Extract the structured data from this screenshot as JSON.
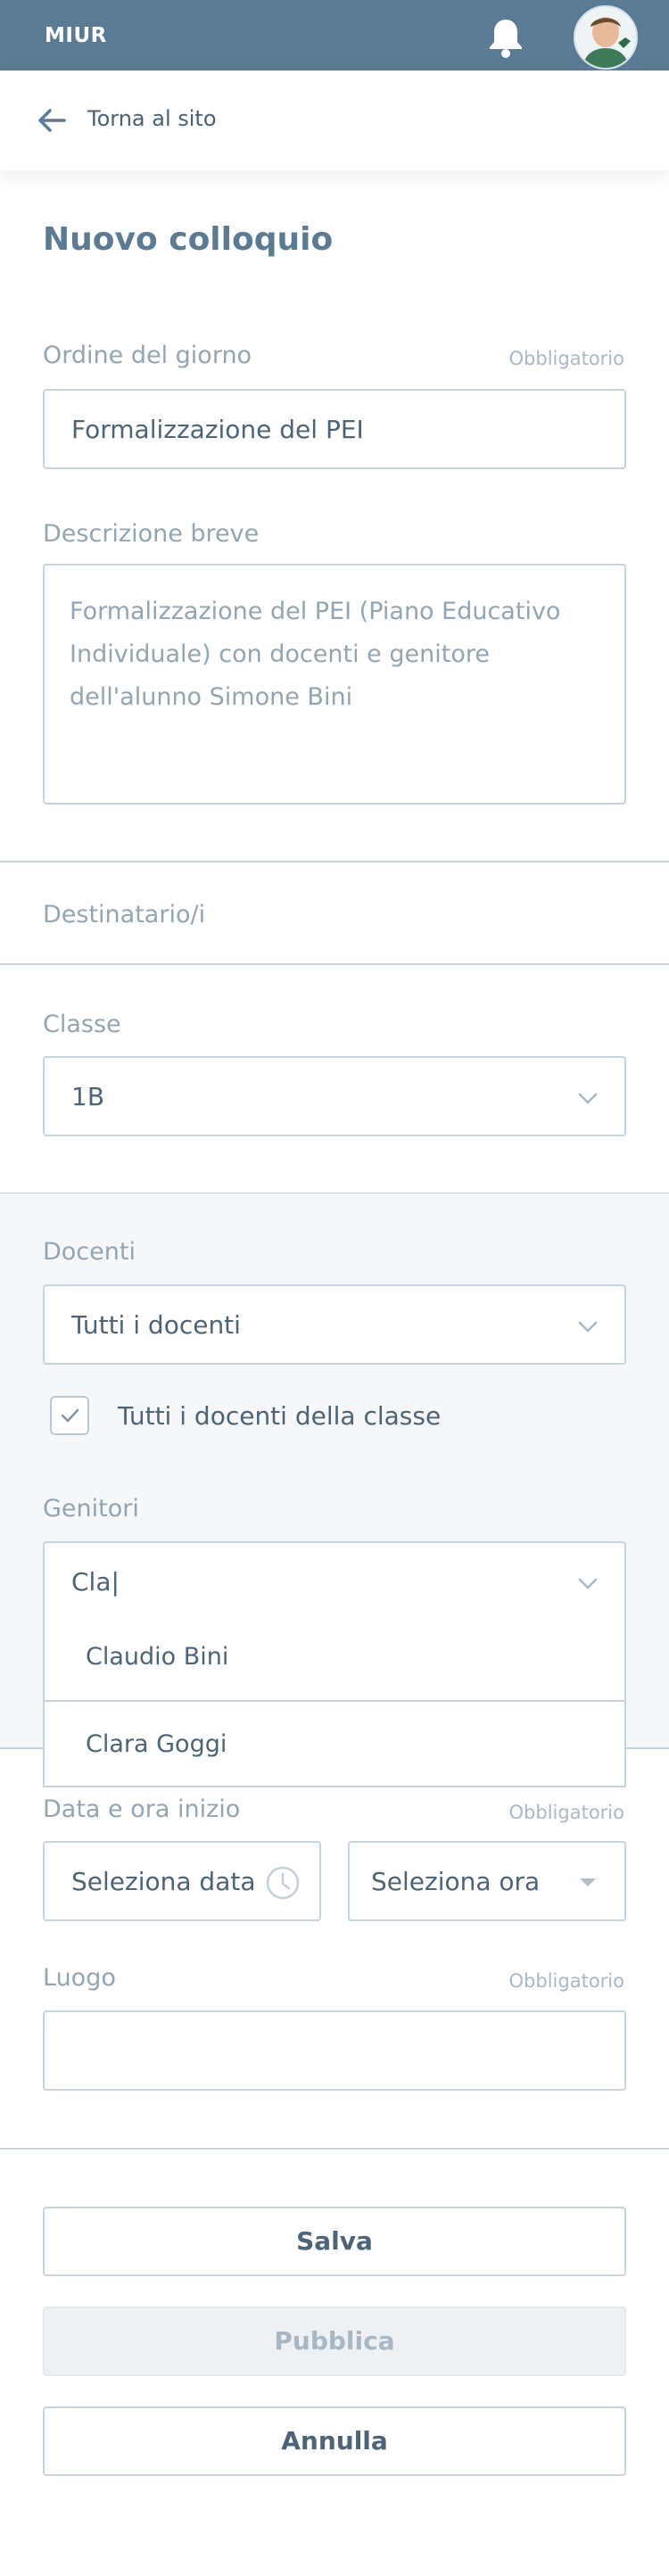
{
  "header": {
    "brand": "MIUR",
    "bell_icon": "bell-icon",
    "avatar_icon": "user-avatar"
  },
  "nav": {
    "back_label": "Torna al sito",
    "back_icon": "arrow-left-icon"
  },
  "page": {
    "title": "Nuovo colloquio"
  },
  "form": {
    "agenda": {
      "label": "Ordine del giorno",
      "required": "Obbligatorio",
      "value": "Formalizzazione del PEI"
    },
    "description": {
      "label": "Descrizione breve",
      "value": "Formalizzazione del PEI (Piano Educativo Individuale) con docenti e genitore dell'alunno Simone Bini"
    },
    "recipients": {
      "label": "Destinatario/i"
    },
    "class": {
      "label": "Classe",
      "value": "1B"
    },
    "teachers": {
      "label": "Docenti",
      "value": "Tutti i docenti",
      "checkbox_label": "Tutti i docenti della classe",
      "checkbox_checked": true
    },
    "parents": {
      "label": "Genitori",
      "value": "Cla|",
      "options": [
        "Claudio Bini",
        "Clara Goggi"
      ]
    },
    "start": {
      "label": "Data e ora inizio",
      "required": "Obbligatorio",
      "date_placeholder": "Seleziona data",
      "time_placeholder": "Seleziona ora"
    },
    "location": {
      "label": "Luogo",
      "required": "Obbligatorio",
      "value": ""
    }
  },
  "actions": {
    "save": "Salva",
    "publish": "Pubblica",
    "cancel": "Annulla"
  },
  "colors": {
    "header_bg": "#5b7a94",
    "border": "#c6d4df",
    "text": "#4d6478",
    "muted": "#93a4b3"
  }
}
